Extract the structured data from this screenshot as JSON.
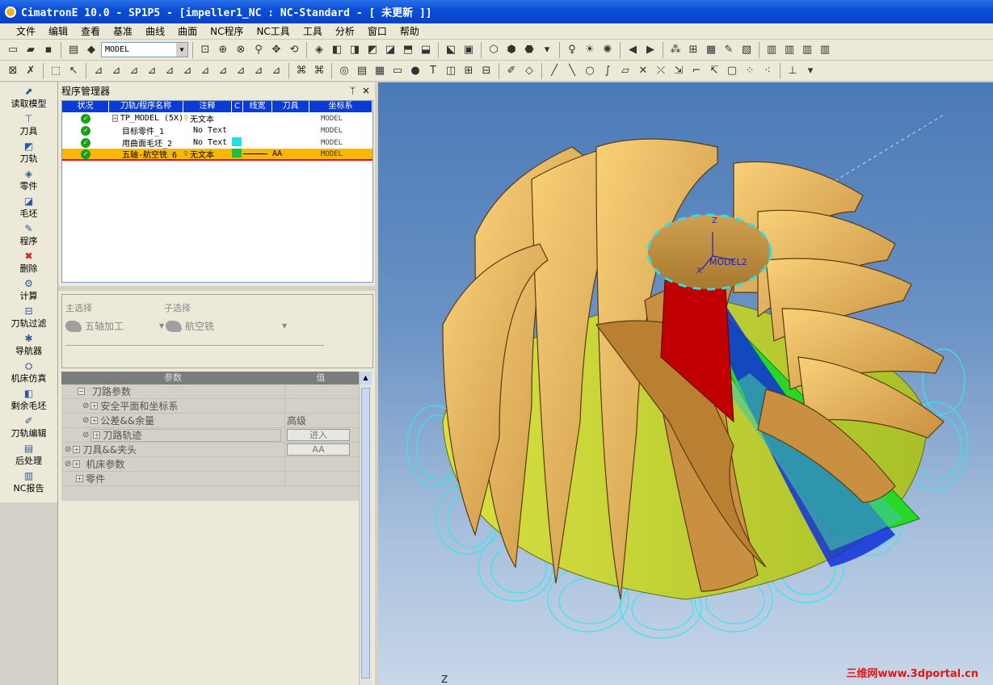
{
  "window": {
    "title": "CimatronE 10.0 - SP1P5 - [impeller1_NC : NC-Standard - [ 未更新 ]]"
  },
  "menu": [
    "文件",
    "编辑",
    "查看",
    "基准",
    "曲线",
    "曲面",
    "NC程序",
    "NC工具",
    "工具",
    "分析",
    "窗口",
    "帮助"
  ],
  "toolbar": {
    "model_combo": "MODEL"
  },
  "left_tools": [
    "读取模型",
    "刀具",
    "刀轨",
    "零件",
    "毛坯",
    "程序",
    "删除",
    "计算",
    "刀轨过滤",
    "导航器",
    "机床仿真",
    "剩余毛坯",
    "刀轨编辑",
    "后处理",
    "NC报告"
  ],
  "program_manager": {
    "title": "程序管理器",
    "pin": "ᛘ",
    "close": "×",
    "columns": [
      "状况",
      "刀轨/程序名称",
      "注释",
      "C",
      "线宽",
      "刀具",
      "坐标系"
    ],
    "rows": [
      {
        "name": "TP_MODEL (5X)",
        "note": "无文本",
        "color": "",
        "tool": "",
        "cs": "MODEL",
        "expander": "−"
      },
      {
        "name": "目标零件_1",
        "note": "No Text",
        "color": "",
        "tool": "",
        "cs": "MODEL"
      },
      {
        "name": "用曲面毛坯_2",
        "note": "No Text",
        "color": "#20e0e0",
        "tool": "",
        "cs": "MODEL"
      },
      {
        "name": "五轴-航空铣_6",
        "note": "无文本",
        "color": "#18c040",
        "tool": "AA",
        "cs": "MODEL",
        "selected": true
      }
    ]
  },
  "selection": {
    "main_label": "主选择",
    "sub_label": "子选择",
    "main_value": "五轴加工",
    "sub_value": "航空铣"
  },
  "params": {
    "col_param": "参数",
    "col_value": "值",
    "rows": [
      {
        "label": "刀路参数",
        "value": ""
      },
      {
        "label": "安全平面和坐标系",
        "value": ""
      },
      {
        "label": "公差&&余量",
        "value": "高级"
      },
      {
        "label": "刀路轨迹",
        "value": "进入"
      },
      {
        "label": "刀具&&夹头",
        "value": "AA"
      },
      {
        "label": "机床参数",
        "value": ""
      },
      {
        "label": "零件",
        "value": ""
      }
    ]
  },
  "viewport": {
    "axis_z": "Z",
    "axis_x": "X",
    "cs_label": "MODEL2",
    "corner_z": "Z",
    "watermark": "三维网www.3dportal.cn"
  }
}
